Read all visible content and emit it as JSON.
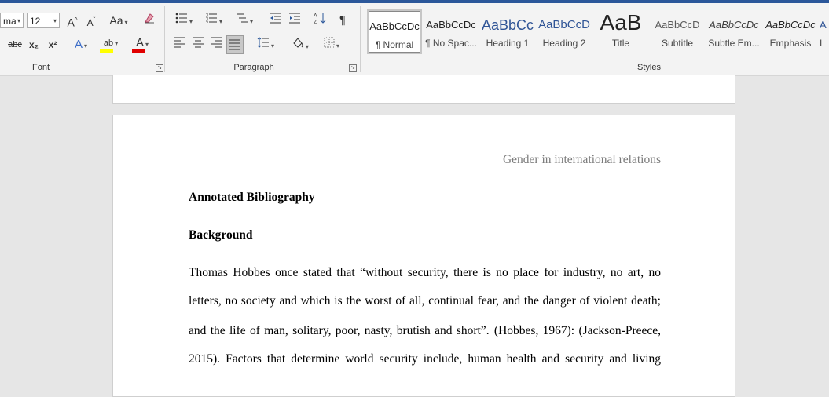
{
  "ribbon": {
    "font_group": {
      "label": "Font",
      "font_name": "ma",
      "font_size": "12",
      "grow_font": "A",
      "shrink_font": "A",
      "change_case": "Aa",
      "strikethrough": "abc",
      "subscript": "x₂",
      "superscript": "x²",
      "text_effects": "A",
      "highlight": "ab",
      "font_color": "A",
      "highlight_color": "#ffff00",
      "font_color_value": "#e00000"
    },
    "paragraph_group": {
      "label": "Paragraph",
      "show_marks": "¶"
    },
    "styles_group": {
      "label": "Styles",
      "items": [
        {
          "preview": "AaBbCcDc",
          "name": "¶ Normal"
        },
        {
          "preview": "AaBbCcDc",
          "name": "¶ No Spac..."
        },
        {
          "preview": "AaBbCc",
          "name": "Heading 1"
        },
        {
          "preview": "AaBbCcD",
          "name": "Heading 2"
        },
        {
          "preview": "AaB",
          "name": "Title"
        },
        {
          "preview": "AaBbCcD",
          "name": "Subtitle"
        },
        {
          "preview": "AaBbCcDc",
          "name": "Subtle Em..."
        },
        {
          "preview": "AaBbCcDc",
          "name": "Emphasis"
        },
        {
          "preview": "A",
          "name": "I"
        }
      ]
    }
  },
  "document": {
    "header_text": "Gender in international relations",
    "title": "Annotated Bibliography",
    "section_heading": "Background",
    "paragraph_lines": [
      "Thomas Hobbes once stated that “without security, there is no place for industry, no art, no",
      "letters, no society and which is the worst of all, continual fear, and the danger of violent death;",
      "and the life of man, solitary, poor, nasty, brutish and short”.",
      "(Hobbes, 1967): (Jackson-Preece,",
      "2015). Factors that determine world security include, human health and security and living"
    ]
  }
}
